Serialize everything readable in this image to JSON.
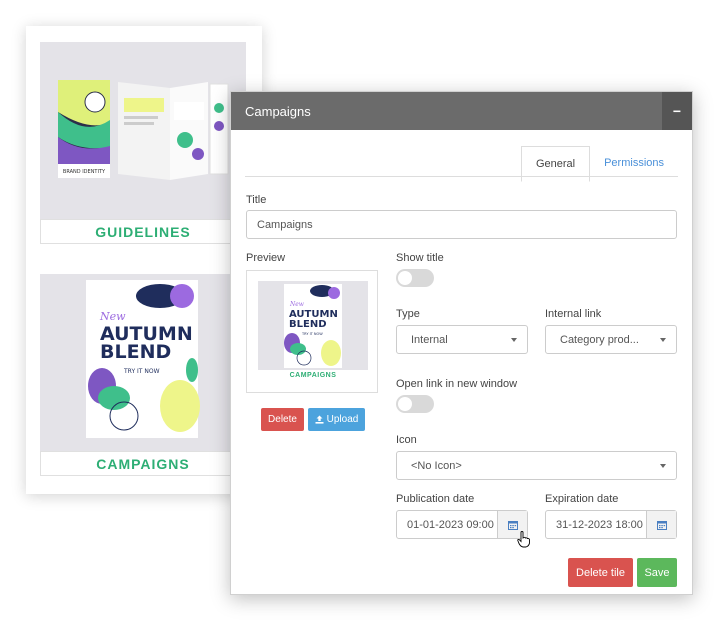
{
  "background": {
    "tiles": [
      {
        "label": "GUIDELINES",
        "booklet_text": "BRAND IDENTITY"
      },
      {
        "label": "CAMPAIGNS",
        "poster": {
          "line1": "New",
          "line2": "AUTUMN",
          "line3": "BLEND",
          "line4": "TRY IT NOW"
        }
      }
    ]
  },
  "dialog": {
    "title": "Campaigns",
    "collapse_symbol": "−",
    "tabs": [
      {
        "label": "General",
        "active": true
      },
      {
        "label": "Permissions",
        "active": false
      }
    ],
    "title_field": {
      "label": "Title",
      "value": "Campaigns"
    },
    "preview": {
      "label": "Preview",
      "thumb_label": "CAMPAIGNS",
      "poster": {
        "line1": "New",
        "line2": "AUTUMN",
        "line3": "BLEND",
        "line4": "TRY IT NOW"
      },
      "delete_label": "Delete",
      "upload_label": "Upload",
      "upload_icon": "upload-icon"
    },
    "show_title": {
      "label": "Show title",
      "on": false
    },
    "type": {
      "label": "Type",
      "value": "Internal"
    },
    "internal_link": {
      "label": "Internal link",
      "value": "Category prod..."
    },
    "open_new_window": {
      "label": "Open link in new window",
      "on": false
    },
    "icon": {
      "label": "Icon",
      "value": "<No Icon>"
    },
    "publication_date": {
      "label": "Publication date",
      "value": "01-01-2023 09:00",
      "icon": "calendar-icon"
    },
    "expiration_date": {
      "label": "Expiration date",
      "value": "31-12-2023 18:00",
      "icon": "calendar-icon"
    },
    "delete_tile_label": "Delete tile",
    "save_label": "Save"
  },
  "colors": {
    "header": "#6b6b6b",
    "accent_green": "#2dae74",
    "danger": "#d9534f",
    "info": "#4ca3dd",
    "success": "#5cb85c",
    "link": "#4a90d9"
  }
}
